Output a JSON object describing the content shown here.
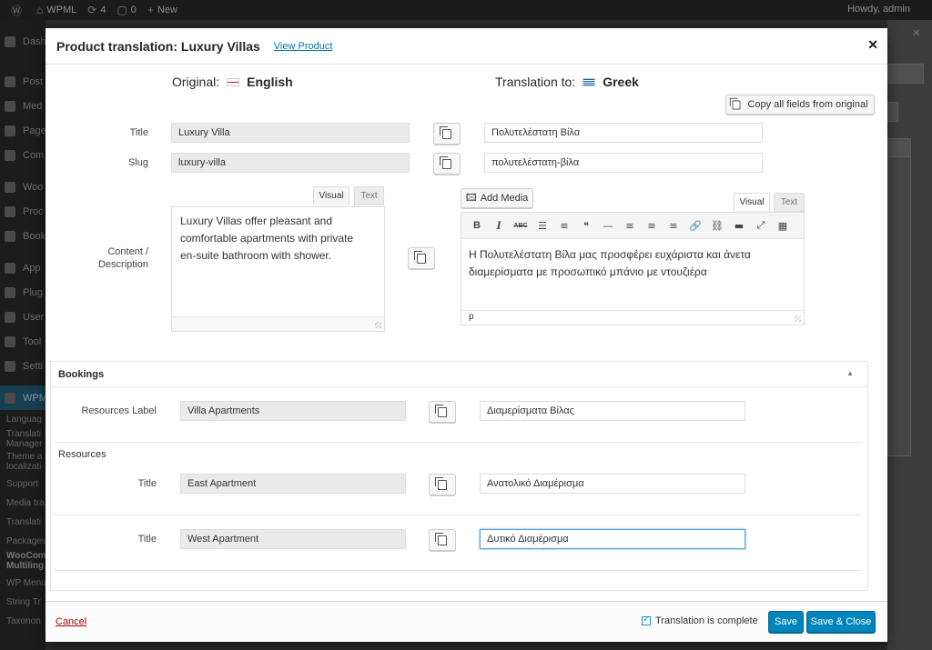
{
  "admin_bar": {
    "site_name": "WPML",
    "updates_count": "4",
    "comments_count": "0",
    "new_label": "New",
    "howdy": "Howdy, admin"
  },
  "side_menu": {
    "items": [
      "Dash",
      "Post",
      "Med",
      "Page",
      "Com",
      "Woo",
      "Proc",
      "Book",
      "App",
      "Plug",
      "User",
      "Tool",
      "Setti"
    ],
    "active": "WPM",
    "subitems": [
      "Languag",
      "Translati",
      "Manager",
      "Theme a",
      "localizati",
      "Support",
      "Media tra",
      "Translati",
      "Packages"
    ],
    "bold_subitems": [
      "WooCom",
      "Multiling"
    ],
    "more": [
      "WP Menu",
      "String Tr",
      "Taxonon"
    ]
  },
  "modal": {
    "title": "Product translation: Luxury Villas",
    "view_link": "View Product",
    "original_label": "Original:",
    "original_lang": "English",
    "translation_label": "Translation to:",
    "translation_lang": "Greek",
    "copy_all": "Copy all fields from original",
    "fields": {
      "title_label": "Title",
      "title_orig": "Luxury Villa",
      "title_trans": "Πολυτελέστατη Βίλα",
      "slug_label": "Slug",
      "slug_orig": "luxury-villa",
      "slug_trans": "πολυτελέστατη-βίλα",
      "content_label_1": "Content /",
      "content_label_2": "Description"
    },
    "editor_tabs": {
      "visual": "Visual",
      "text": "Text"
    },
    "add_media": "Add Media",
    "orig_content": [
      "Luxury Villas offer pleasant and",
      "comfortable apartments  with private",
      "en-suite bathroom with shower."
    ],
    "trans_content": [
      "Η Πολυτελέστατη Βίλα μας προσφέρει ευχάριστα και άνετα",
      "διαμερίσματα με προσωπικό μπάνιο με ντουζιέρα"
    ],
    "path_tag": "p",
    "toolbar": [
      {
        "name": "bold-button",
        "glyph": "B",
        "cls": ""
      },
      {
        "name": "italic-button",
        "glyph": "I",
        "cls": "ital"
      },
      {
        "name": "strikethrough-button",
        "glyph": "ABC",
        "cls": ""
      },
      {
        "name": "bullet-list-button",
        "glyph": "☰",
        "cls": "tb-glyph"
      },
      {
        "name": "numbered-list-button",
        "glyph": "≡",
        "cls": "tb-glyph"
      },
      {
        "name": "blockquote-button",
        "glyph": "❝",
        "cls": "tb-glyph"
      },
      {
        "name": "horizontal-line-button",
        "glyph": "—",
        "cls": "tb-glyph"
      },
      {
        "name": "align-left-button",
        "glyph": "≡",
        "cls": "tb-glyph"
      },
      {
        "name": "align-center-button",
        "glyph": "≡",
        "cls": "tb-glyph"
      },
      {
        "name": "align-right-button",
        "glyph": "≡",
        "cls": "tb-glyph"
      },
      {
        "name": "insert-link-button",
        "glyph": "🔗",
        "cls": "tb-glyph"
      },
      {
        "name": "remove-link-button",
        "glyph": "⛓",
        "cls": "tb-glyph"
      },
      {
        "name": "read-more-button",
        "glyph": "▬",
        "cls": "tb-glyph"
      },
      {
        "name": "fullscreen-button",
        "glyph": "⤢",
        "cls": "tb-glyph"
      },
      {
        "name": "toolbar-toggle-button",
        "glyph": "▦",
        "cls": "tb-glyph"
      }
    ],
    "bookings": {
      "header": "Bookings",
      "resources_label_label": "Resources Label",
      "resources_label_orig": "Villa Apartments",
      "resources_label_trans": "Διαμερίσματα Βίλας",
      "resources_heading": "Resources",
      "title_label": "Title",
      "res1_orig": "East Apartment",
      "res1_trans": "Ανατολικό Διαμέρισμα",
      "res2_orig": "West Apartment",
      "res2_trans": "Δυτικό Διαμέρισμα"
    },
    "footer": {
      "cancel": "Cancel",
      "complete_label": "Translation is complete",
      "complete_checked": true,
      "save": "Save",
      "save_close": "Save & Close"
    }
  }
}
